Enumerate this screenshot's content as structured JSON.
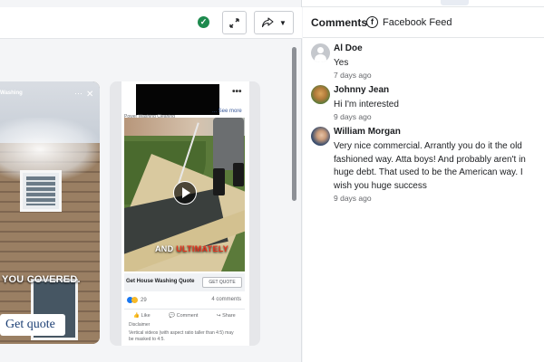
{
  "toolbar": {
    "status_icon": "check-circle-icon",
    "expand_icon": "expand-arrows-icon",
    "share_icon": "share-arrow-icon",
    "dropdown_icon": "caret-down-icon",
    "status_color": "#1d8a4e"
  },
  "previews": {
    "card1": {
      "top_label": "Washing",
      "caption": "YOU COVERED.",
      "cta": "Get quote"
    },
    "card2": {
      "page_subline": "Power Washing Cleaning",
      "see_more": "... See more",
      "overlay_text_a": "AND ",
      "overlay_text_b": "ULTIMATELY",
      "cta_title": "Get House Washing Quote",
      "cta_button": "GET QUOTE",
      "reaction_count": "29",
      "comment_count": "4 comments",
      "actions": [
        "Like",
        "Comment",
        "Share"
      ],
      "disclaimer_heading": "Disclaimer",
      "disclaimer_text": "Vertical videos (with aspect ratio taller than 4:5) may be masked to 4:5."
    }
  },
  "comments_panel": {
    "title": "Comments",
    "source_icon": "facebook-icon",
    "source_label": "Facebook Feed",
    "comments": [
      {
        "author": "Al Doe",
        "text": "Yes",
        "time": "7 days ago"
      },
      {
        "author": "Johnny Jean",
        "text": "Hi I'm interested",
        "time": "9 days ago"
      },
      {
        "author": "William Morgan",
        "text": "Very nice commercial. Arrantly you do it the old fashioned way. Atta boys! And probably aren't in huge debt. That used to be the American way. I wish you huge success",
        "time": "9 days ago"
      }
    ]
  }
}
